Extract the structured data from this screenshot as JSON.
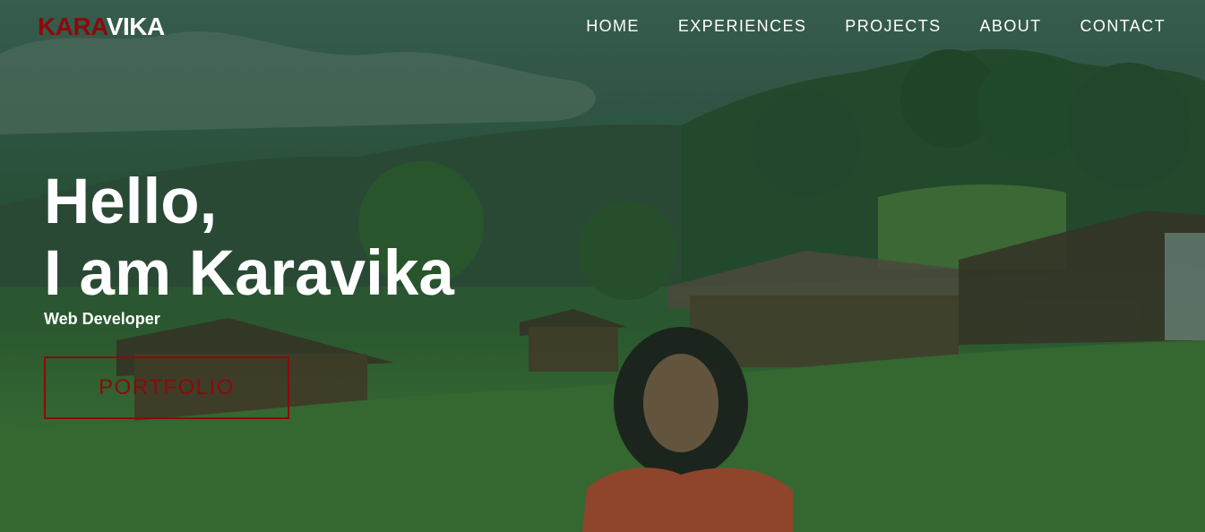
{
  "header": {
    "logo_part1": "KARA",
    "logo_part2": "VIKA",
    "nav": [
      {
        "label": "HOME"
      },
      {
        "label": "EXPERIENCES"
      },
      {
        "label": "PROJECTS"
      },
      {
        "label": "ABOUT"
      },
      {
        "label": "CONTACT"
      }
    ]
  },
  "hero": {
    "line1": "Hello,",
    "line2": "I am Karavika",
    "subtitle": "Web Developer",
    "cta_label": "PORTFOLIO"
  },
  "colors": {
    "accent": "#8b0a0a",
    "text": "#ffffff",
    "overlay": "#2f5a45"
  }
}
